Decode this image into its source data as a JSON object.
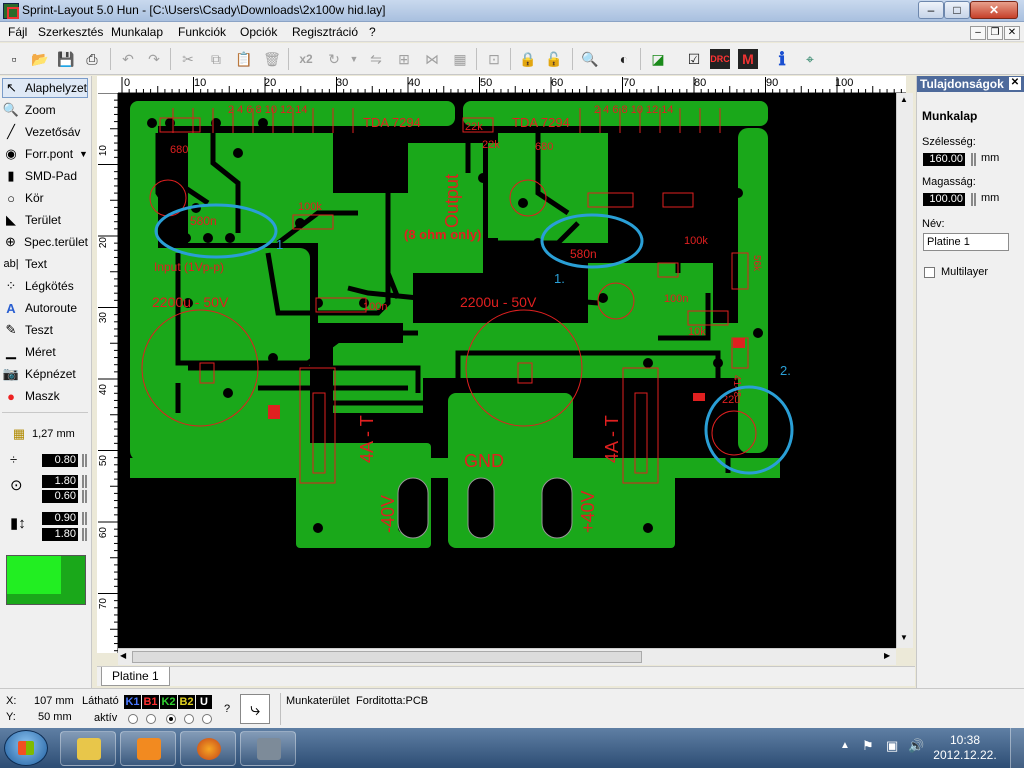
{
  "window": {
    "title": "Sprint-Layout 5.0 Hun     - [C:\\Users\\Csady\\Downloads\\2x100w hid.lay]",
    "min": "–",
    "max": "□",
    "close": "✕"
  },
  "menu": [
    "Fájl",
    "Szerkesztés",
    "Munkalap",
    "Funkciók",
    "Opciók",
    "Regisztráció",
    "?"
  ],
  "toolbar": {
    "icons": [
      "new-icon",
      "open-icon",
      "save-icon",
      "print-icon",
      "undo-icon",
      "redo-icon",
      "cut-icon",
      "copy-icon",
      "paste-icon",
      "delete-icon",
      "duplicate-icon",
      "rotate-icon",
      "mirror-icon",
      "align-icon",
      "group-icon",
      "lock-icon",
      "zoom-icon",
      "contrast-icon",
      "macro-icon",
      "drc-icon",
      "help-icon",
      "crop-icon"
    ],
    "x2_label": "x2",
    "drc_label": "DRC"
  },
  "tools": [
    {
      "label": "Alaphelyzet",
      "icon": "cursor-icon"
    },
    {
      "label": "Zoom",
      "icon": "magnifier-icon"
    },
    {
      "label": "Vezetősáv",
      "icon": "track-icon"
    },
    {
      "label": "Forr.pont",
      "icon": "pad-icon"
    },
    {
      "label": "SMD-Pad",
      "icon": "smd-icon"
    },
    {
      "label": "Kör",
      "icon": "circle-icon"
    },
    {
      "label": "Terület",
      "icon": "area-icon"
    },
    {
      "label": "Spec.terület",
      "icon": "special-area-icon"
    },
    {
      "label": "Text",
      "icon": "text-icon"
    },
    {
      "label": "Légkötés",
      "icon": "airwire-icon"
    },
    {
      "label": "Autoroute",
      "icon": "autoroute-icon"
    },
    {
      "label": "Teszt",
      "icon": "test-icon"
    },
    {
      "label": "Méret",
      "icon": "measure-icon"
    },
    {
      "label": "Képnézet",
      "icon": "camera-icon"
    },
    {
      "label": "Maszk",
      "icon": "mask-icon"
    }
  ],
  "params": {
    "grid": "1,27 mm",
    "track_width": "0.80",
    "pad_outer": "1.80",
    "pad_inner": "0.60",
    "smd_w": "0.90",
    "smd_h": "1.80"
  },
  "rulers": {
    "h_ticks": [
      "0",
      "10",
      "20",
      "30",
      "40",
      "50",
      "60",
      "70",
      "80",
      "90",
      "100"
    ],
    "v_ticks": [
      "10",
      "20",
      "30",
      "40",
      "50",
      "60",
      "70"
    ]
  },
  "board": {
    "labels": {
      "tda_left": "TDA 7294",
      "tda_right": "TDA 7294",
      "output": "Output",
      "ohm": "(8 ohm only)",
      "input": "Input (1Vp-p)",
      "cap_left": "2200u - 50V",
      "cap_right": "2200u - 50V",
      "fuse_left": "4A - T",
      "fuse_right": "4A - T",
      "gnd": "GND",
      "minus40": "-40V",
      "plus40": "+40V",
      "c580_left": "580n",
      "c580_right": "580n",
      "r680_left": "680",
      "r680_right": "680",
      "r22k_left": "22k",
      "r22k_right": "22k",
      "c22u": "22u",
      "r100k_left": "100k",
      "r100k_right": "100k",
      "r100n_left": "100n",
      "r100n_right": "100n",
      "r10k": "10k",
      "d4148": "4148",
      "r56k": "56k",
      "pins_left": "2 4 6 8 10 12 14",
      "pins_right": "2 4 6 8 10 12 14",
      "mark1": "1",
      "mark1b": "1.",
      "mark2": "2."
    },
    "annotation_color": "#2a9fd6",
    "copper_color": "#1aa81a"
  },
  "tabs": {
    "active": "Platine 1"
  },
  "properties": {
    "title": "Tulajdonságok",
    "section": "Munkalap",
    "width_label": "Szélesség:",
    "width_value": "160.00",
    "height_label": "Magasság:",
    "height_value": "100.00",
    "unit": "mm",
    "name_label": "Név:",
    "name_value": "Platine 1",
    "multilayer_label": "Multilayer"
  },
  "status": {
    "x_label": "X:",
    "x_value": "107 mm",
    "y_label": "Y:",
    "y_value": "50 mm",
    "visible_label": "Látható",
    "active_label": "aktív",
    "layers": [
      {
        "name": "K1",
        "color": "#4a78ff"
      },
      {
        "name": "B1",
        "color": "#ff3030"
      },
      {
        "name": "K2",
        "color": "#30d030"
      },
      {
        "name": "B2",
        "color": "#e0d020"
      },
      {
        "name": "U",
        "color": "#ffffff"
      }
    ],
    "question": "?",
    "workspace": "Munkaterület",
    "translated": "Forditotta:PCB"
  },
  "taskbar": {
    "apps": [
      "explorer-icon",
      "media-player-icon",
      "firefox-icon",
      "sprint-layout-icon"
    ],
    "time": "10:38",
    "date": "2012.12.22."
  }
}
